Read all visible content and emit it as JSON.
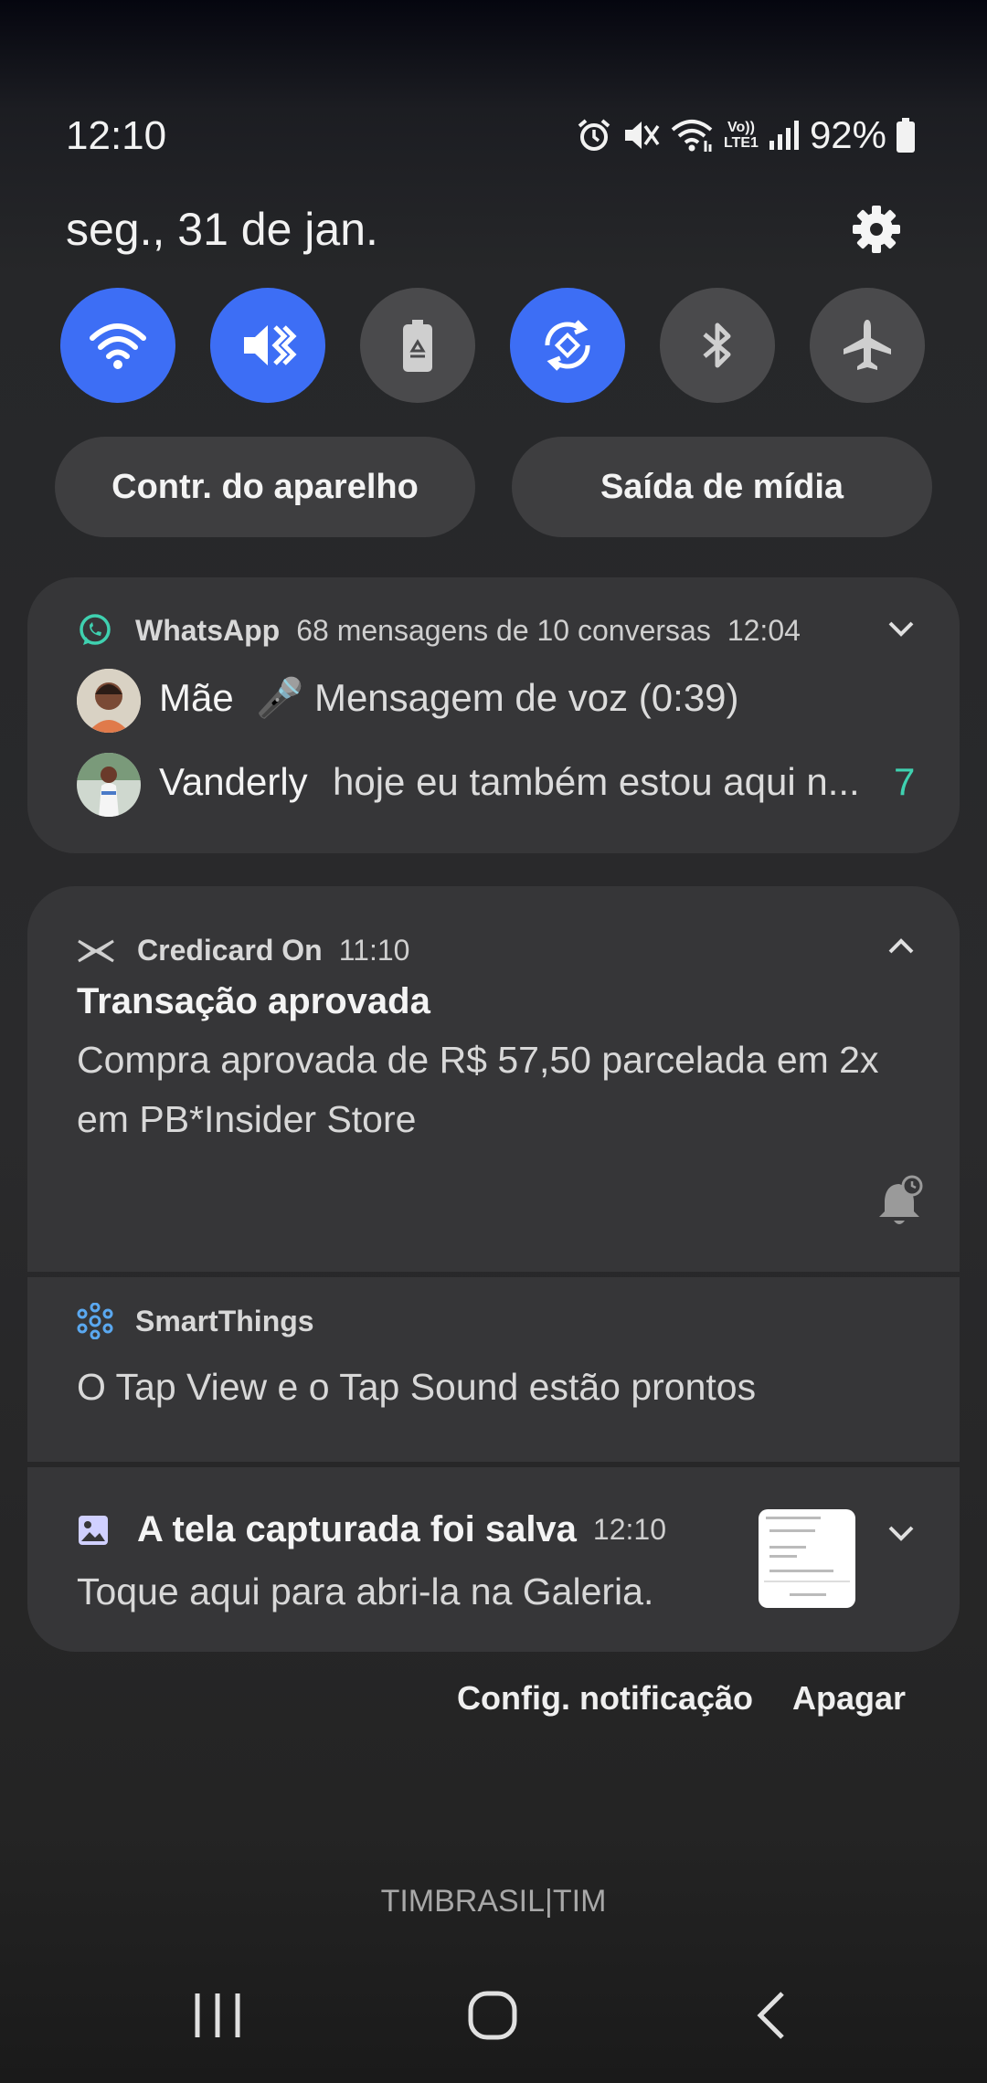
{
  "status_bar": {
    "time": "12:10",
    "battery": "92%",
    "lte_label_top": "Vo))",
    "lte_label_bottom": "LTE1"
  },
  "date": "seg., 31 de jan.",
  "quick_toggles": [
    {
      "name": "wifi-icon",
      "on": true
    },
    {
      "name": "vibrate-icon",
      "on": true
    },
    {
      "name": "power-saving-icon",
      "on": false
    },
    {
      "name": "auto-rotate-icon",
      "on": true
    },
    {
      "name": "bluetooth-icon",
      "on": false
    },
    {
      "name": "airplane-icon",
      "on": false
    }
  ],
  "pills": {
    "device_control": "Contr. do aparelho",
    "media_output": "Saída de mídia"
  },
  "whatsapp": {
    "app": "WhatsApp",
    "summary": "68 mensagens de 10 conversas",
    "time": "12:04",
    "rows": [
      {
        "name": "Mãe",
        "message": "🎤 Mensagem de voz (0:39)"
      },
      {
        "name": "Vanderly",
        "message": "hoje eu também estou aqui n...",
        "count": "7"
      }
    ]
  },
  "credicard": {
    "app": "Credicard On",
    "time": "11:10",
    "title": "Transação aprovada",
    "body_line1": "Compra aprovada de R$ 57,50 parcelada em 2x",
    "body_line2": "em PB*Insider Store"
  },
  "smartthings": {
    "app": "SmartThings",
    "body": "O Tap View e o Tap Sound estão prontos"
  },
  "screenshot": {
    "title": "A tela capturada foi salva",
    "time": "12:10",
    "body": "Toque aqui para abri-la na Galeria."
  },
  "actions": {
    "settings": "Config. notificação",
    "clear": "Apagar"
  },
  "carrier": "TIMBRASIL|TIM",
  "colors": {
    "toggle_on": "#3d6ef5",
    "toggle_off": "#4a4a4c",
    "whatsapp_green": "#3fd1b0",
    "card": "#363638"
  }
}
